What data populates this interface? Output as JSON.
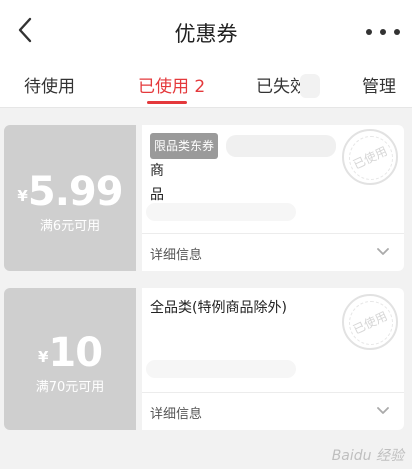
{
  "header": {
    "title": "优惠券"
  },
  "tabs": [
    {
      "label": "待使用"
    },
    {
      "label": "已使用 2"
    },
    {
      "label": "已失效"
    },
    {
      "label": "管理"
    }
  ],
  "coupons": [
    {
      "currency": "¥",
      "amount": "5.99",
      "condition": "满6元可用",
      "tag": "限品类东券",
      "description_end": "商",
      "description_line2": "品",
      "detail_label": "详细信息",
      "stamp": "已使用"
    },
    {
      "currency": "¥",
      "amount": "10",
      "condition": "满70元可用",
      "description": "全品类(特例商品除外)",
      "detail_label": "详细信息",
      "stamp": "已使用"
    }
  ],
  "watermark": "Baidu 经验",
  "colors": {
    "accent": "#e4393c",
    "used_coupon": "#cfcfcf"
  }
}
